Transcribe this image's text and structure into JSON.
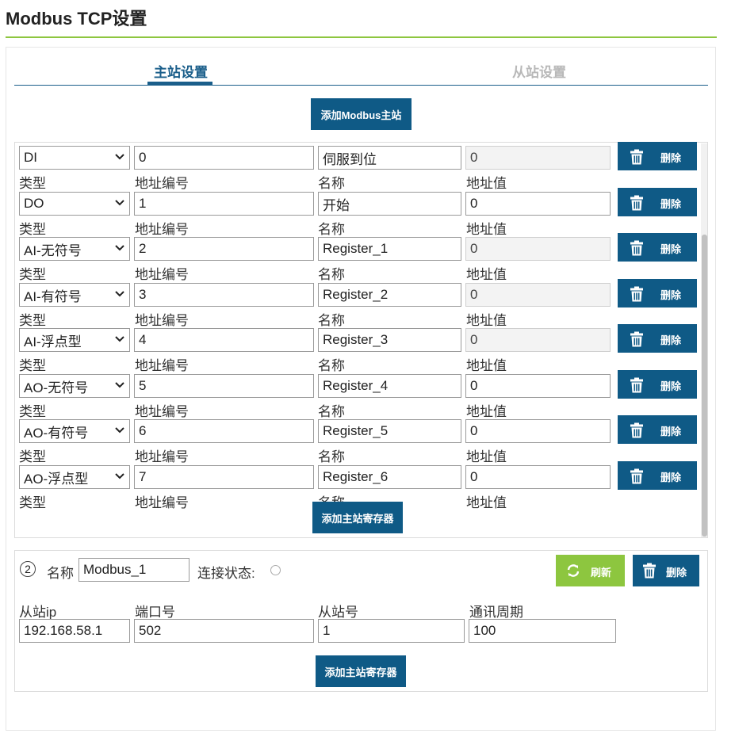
{
  "page": {
    "title": "Modbus TCP设置"
  },
  "tabs": {
    "active": "主站设置",
    "inactive": "从站设置"
  },
  "buttons": {
    "add_master": "添加Modbus主站",
    "add_register": "添加主站寄存器",
    "add_register_2": "添加主站寄存器",
    "delete": "删除",
    "refresh": "刷新"
  },
  "labels": {
    "type": "类型",
    "address_no": "地址编号",
    "name": "名称",
    "address_value": "地址值"
  },
  "registers": [
    {
      "type": "DI",
      "address": "0",
      "name": "伺服到位",
      "value": "0",
      "value_readonly": true
    },
    {
      "type": "DO",
      "address": "1",
      "name": "开始",
      "value": "0",
      "value_readonly": false
    },
    {
      "type": "AI-无符号",
      "address": "2",
      "name": "Register_1",
      "value": "0",
      "value_readonly": true
    },
    {
      "type": "AI-有符号",
      "address": "3",
      "name": "Register_2",
      "value": "0",
      "value_readonly": true
    },
    {
      "type": "AI-浮点型",
      "address": "4",
      "name": "Register_3",
      "value": "0",
      "value_readonly": true
    },
    {
      "type": "AO-无符号",
      "address": "5",
      "name": "Register_4",
      "value": "0",
      "value_readonly": false
    },
    {
      "type": "AO-有符号",
      "address": "6",
      "name": "Register_5",
      "value": "0",
      "value_readonly": false
    },
    {
      "type": "AO-浮点型",
      "address": "7",
      "name": "Register_6",
      "value": "0",
      "value_readonly": false
    }
  ],
  "master2": {
    "index": "2",
    "name_label": "名称",
    "name_value": "Modbus_1",
    "status_label": "连接状态:",
    "slave_ip_label": "从站ip",
    "slave_ip": "192.168.58.1",
    "port_label": "端口号",
    "port": "502",
    "slave_no_label": "从站号",
    "slave_no": "1",
    "period_label": "通讯周期",
    "period": "100"
  },
  "colors": {
    "primary": "#0f5a86",
    "accent_green": "#8dc63f",
    "tab_inactive": "#b8b8b8"
  },
  "icons": {
    "delete": "trash-icon",
    "refresh": "refresh-icon",
    "select": "chevron-down-icon",
    "radio": "radio-icon"
  }
}
